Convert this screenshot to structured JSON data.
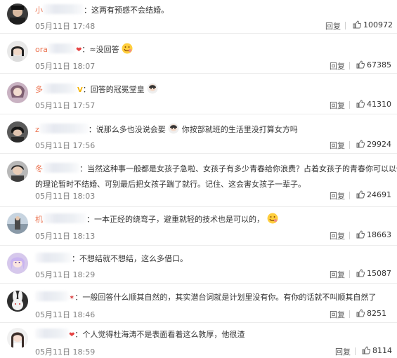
{
  "comments": [
    {
      "name": "小",
      "text": "：这两有预感不会结婚。",
      "time": "05月11日 17:48",
      "reply": "回复",
      "likes": "100972"
    },
    {
      "name": "ora",
      "text": "：≈没回答",
      "time": "05月11日 18:07",
      "reply": "回复",
      "likes": "67385"
    },
    {
      "name": "多",
      "badge": "V",
      "text": "：回答的冠冕堂皇",
      "time": "05月11日 17:57",
      "reply": "回复",
      "likes": "41310"
    },
    {
      "name": "z",
      "text": "：说那么多也没说会娶",
      "text2": "你按部就班的生活里没打算女方吗",
      "time": "05月11日 17:56",
      "reply": "回复",
      "likes": "29924"
    },
    {
      "name": "冬",
      "text": "：当然这种事一般都是女孩子急啦、女孩子有多少青春给你浪费？占着女孩子的青春你可以以你",
      "text_line2": "的理论暂时不结婚、可别最后把女孩子踹了就行。记住、这会害女孩子一辈子。",
      "time": "05月11日 18:03",
      "reply": "回复",
      "likes": "24691"
    },
    {
      "name": "机",
      "text": "：一本正经的绕弯子，避重就轻的技术也是可以的，",
      "time": "05月11日 18:13",
      "reply": "回复",
      "likes": "18663"
    },
    {
      "name": "",
      "text": "：不想结就不想结，这么多借口。",
      "time": "05月11日 18:29",
      "reply": "回复",
      "likes": "15087"
    },
    {
      "name": "",
      "text": "：一般回答什么顺其自然的，其实潜台词就是计划里没有你。有你的话就不叫顺其自然了",
      "time": "05月11日 18:46",
      "reply": "回复",
      "likes": "8251"
    },
    {
      "name": "",
      "text": "：个人觉得杜海涛不是表面看着这么敦厚，他很渣",
      "time": "05月11日 18:59",
      "reply": "回复",
      "likes": "8114"
    }
  ],
  "icons": {
    "like": "thumbs-up-icon",
    "emoji_smile": "smile-emoji-icon",
    "emoji_sticker": "sticker-emoji-icon",
    "heart": "heart-icon"
  },
  "colors": {
    "username": "#eb7350",
    "time": "#808080",
    "divider": "#ececec"
  }
}
